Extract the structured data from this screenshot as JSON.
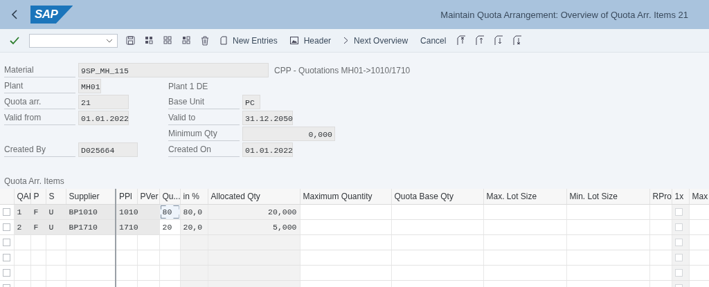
{
  "header": {
    "logo": "SAP",
    "title": "Maintain Quota Arrangement: Overview of Quota Arr. Items 21"
  },
  "toolbar": {
    "buttons": [
      "New Entries",
      "Header",
      "Next Overview",
      "Cancel"
    ]
  },
  "form": {
    "rows": [
      {
        "left": {
          "label": "Material",
          "value": "9SP_MH_115"
        },
        "right": {
          "kind": "description",
          "text": "CPP - Quotations MH01->1010/1710"
        }
      },
      {
        "left": {
          "label": "Plant",
          "value": "MH01"
        },
        "right": {
          "kind": "description",
          "text": "Plant 1 DE"
        }
      },
      {
        "left": {
          "label": "Quota arr.",
          "value": "21"
        },
        "right": {
          "kind": "field",
          "label": "Base Unit",
          "value": "PC"
        }
      },
      {
        "left": {
          "label": "Valid from",
          "value": "01.01.2022"
        },
        "right": {
          "kind": "field",
          "label": "Valid to",
          "value": "31.12.2050"
        }
      },
      {
        "right": {
          "kind": "amount",
          "label": "Minimum Qty",
          "value": "0,000"
        }
      },
      {
        "left": {
          "label": "Created By",
          "value": "D025664"
        },
        "right": {
          "kind": "field",
          "label": "Created On",
          "value": "01.01.2022"
        }
      }
    ]
  },
  "table": {
    "title": "Quota Arr. Items",
    "columns": [
      {
        "label": "QAI",
        "kind": "key"
      },
      {
        "label": "P",
        "kind": "key"
      },
      {
        "label": "S",
        "kind": "key"
      },
      {
        "label": "Supplier",
        "kind": "key"
      },
      {
        "label": "PPl",
        "kind": "key"
      },
      {
        "label": "PVer",
        "kind": "key"
      },
      {
        "label": "Qu...",
        "kind": "entry"
      },
      {
        "label": "in %",
        "kind": "display"
      },
      {
        "label": "Allocated Qty",
        "kind": "amount"
      },
      {
        "label": "Maximum Quantity",
        "kind": "input"
      },
      {
        "label": "Quota Base Qty",
        "kind": "input"
      },
      {
        "label": "Max. Lot Size",
        "kind": "input"
      },
      {
        "label": "Min. Lot Size",
        "kind": "input"
      },
      {
        "label": "RPro",
        "kind": "input"
      },
      {
        "label": "1x",
        "kind": "checkbox"
      },
      {
        "label": "Max",
        "kind": "input"
      }
    ],
    "rows": [
      {
        "selected": false,
        "locked": true,
        "focused": true,
        "checked": false,
        "cells": [
          "1",
          "F",
          "U",
          "BP1010",
          "1010",
          null,
          "80",
          "80,0",
          "20,000"
        ]
      },
      {
        "selected": false,
        "locked": true,
        "focused": false,
        "checked": false,
        "cells": [
          "2",
          "F",
          "U",
          "BP1710",
          "1710",
          null,
          "20",
          "20,0",
          "5,000"
        ]
      },
      {
        "selected": false,
        "locked": false,
        "focused": false,
        "checked": false
      },
      {
        "selected": false,
        "locked": false,
        "focused": false,
        "checked": false
      },
      {
        "selected": false,
        "locked": false,
        "focused": false,
        "checked": false
      },
      {
        "selected": false,
        "locked": false,
        "focused": false,
        "checked": false
      }
    ]
  }
}
